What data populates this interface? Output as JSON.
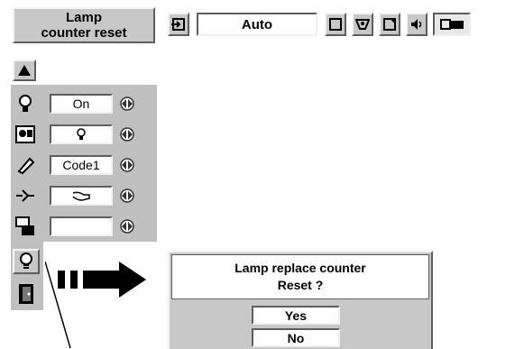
{
  "title_box": {
    "line1": "Lamp",
    "line2": "counter reset"
  },
  "toolbar": {
    "mode_value": "Auto"
  },
  "menu_rows": [
    {
      "icon": "lamp-bulb-icon",
      "value": "On"
    },
    {
      "icon": "lamp-indicator-icon",
      "value": ""
    },
    {
      "icon": "pencil-code-icon",
      "value": "Code1"
    },
    {
      "icon": "connector-icon",
      "value": ""
    },
    {
      "icon": "stacked-screen-icon",
      "value": ""
    }
  ],
  "dialog": {
    "line1": "Lamp replace counter",
    "line2": "Reset ?",
    "yes_label": "Yes",
    "no_label": "No"
  },
  "colors": {
    "menu_bg": "#c0c0c0",
    "text": "#000000",
    "field_bg": "#ffffff"
  }
}
